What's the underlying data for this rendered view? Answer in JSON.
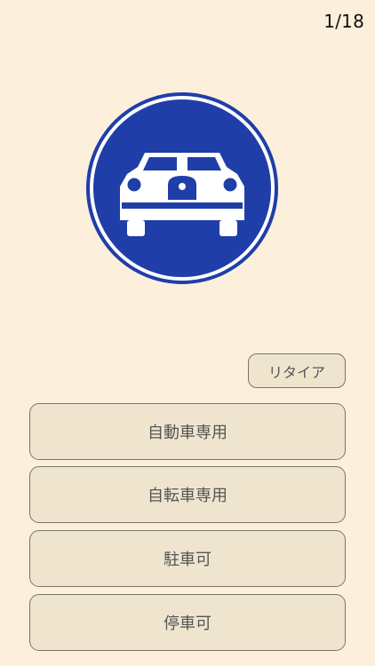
{
  "quiz": {
    "progress": "1/18"
  },
  "sign": {
    "icon": "car-icon",
    "colors": {
      "ring": "#ffffff",
      "border": "#1f3ea8",
      "fill": "#1f3ea8",
      "symbol": "#ffffff"
    }
  },
  "actions": {
    "retire_label": "リタイア"
  },
  "answers": [
    {
      "label": "自動車専用"
    },
    {
      "label": "自転車専用"
    },
    {
      "label": "駐車可"
    },
    {
      "label": "停車可"
    }
  ],
  "theme": {
    "background": "#fcf0dc",
    "button_bg": "#efe5cf",
    "button_border": "#7b7466",
    "button_text": "#555555"
  }
}
